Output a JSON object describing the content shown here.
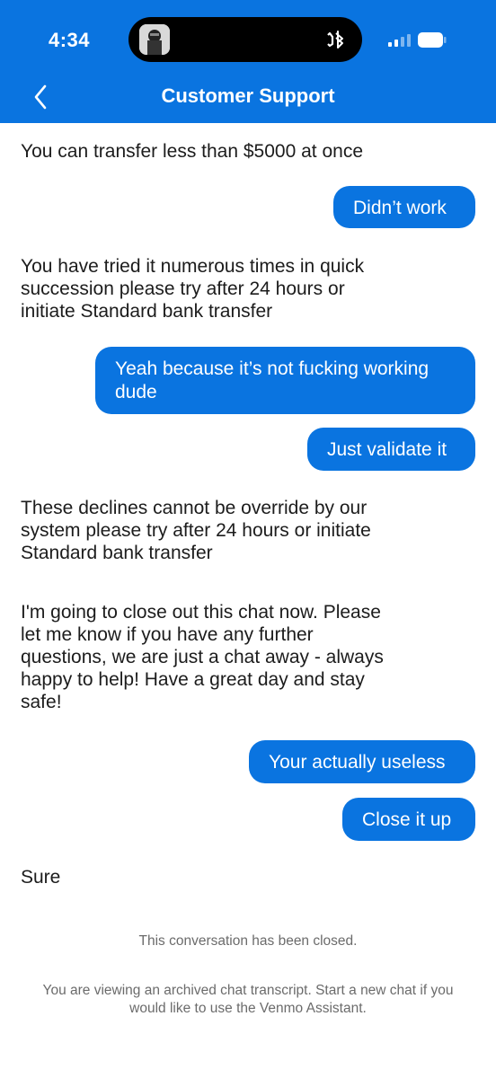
{
  "status_bar": {
    "time": "4:34"
  },
  "header": {
    "title": "Customer Support",
    "back_icon": "chevron-left-icon"
  },
  "messages": [
    {
      "from": "agent",
      "text": "You can transfer less than $5000 at once"
    },
    {
      "from": "user",
      "text": "Didn’t work"
    },
    {
      "from": "agent",
      "lines": [
        "You have tried it numerous times in  quick",
        "succession please try after 24 hours or",
        "initiate Standard bank transfer"
      ]
    },
    {
      "from": "user",
      "lines": [
        "Yeah because it’s not fucking working",
        "dude"
      ]
    },
    {
      "from": "user",
      "text": "Just validate it"
    },
    {
      "from": "agent",
      "lines": [
        "These declines cannot be override by our",
        "system please try after 24 hours or initiate",
        "Standard bank transfer"
      ]
    },
    {
      "from": "agent",
      "lines": [
        "I'm going to close out this chat now. Please",
        "let me know if you have any further",
        "questions, we are just a chat away - always",
        "happy to help! Have a great day and stay",
        "safe!"
      ]
    },
    {
      "from": "user",
      "text": "Your actually useless"
    },
    {
      "from": "user",
      "text": "Close it up"
    },
    {
      "from": "agent",
      "text": "Sure"
    }
  ],
  "footer": {
    "closed_notice": "This conversation has been closed.",
    "archive_notice_lines": [
      "You are viewing an archived chat transcript. Start a new chat if you",
      "would like to use the Venmo Assistant."
    ]
  },
  "colors": {
    "brand_blue": "#0a74e0",
    "agent_text": "#1c1c1c",
    "notice_text": "#6b6b6b"
  }
}
